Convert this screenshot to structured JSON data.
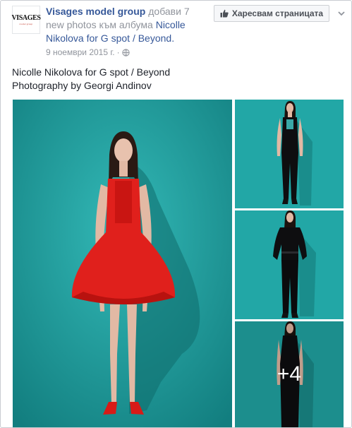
{
  "page": {
    "logo_text": "VISAGES",
    "logo_subtext": "model group",
    "name": "Visages model group",
    "action_text": "добави 7 new photos към албума",
    "album_name": "Nicolle Nikolova for G spot / Beyond.",
    "date": "9 ноември 2015 г.",
    "separator": "·"
  },
  "like_button": {
    "label": "Харесвам страницата",
    "icon": "thumbs-up-icon"
  },
  "options_icon": "chevron-down-icon",
  "caption": {
    "line1": "Nicolle Nikolova for G spot / Beyond",
    "line2": "Photography by Georgi Andinov"
  },
  "photos": {
    "more_count": "+4",
    "items": [
      "red-dress-photo",
      "black-jumpsuit-photo",
      "black-blouse-pants-photo",
      "black-dress-photo"
    ]
  },
  "colors": {
    "teal_background": "#1fa6a6",
    "dress_red": "#e0201c",
    "link_blue": "#365899"
  }
}
